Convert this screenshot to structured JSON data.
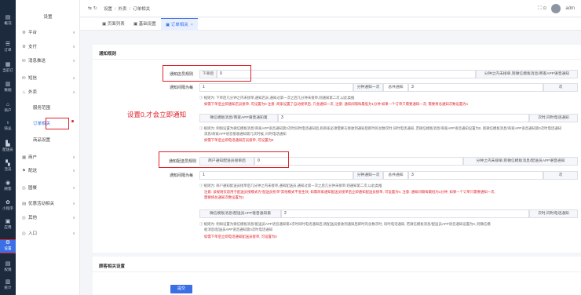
{
  "colors": {
    "accent": "#3a6fe6",
    "alert_red": "#e0222b",
    "nav_bg": "#1c2a3e"
  },
  "iconbar": [
    {
      "glyph": "▤",
      "label": "概况",
      "icon": "dashboard-icon"
    },
    {
      "glyph": "☰",
      "label": "订单",
      "icon": "order-icon"
    },
    {
      "glyph": "▦",
      "label": "当前订",
      "icon": "current-order-icon"
    },
    {
      "glyph": "▥",
      "label": "数据",
      "icon": "data-icon"
    },
    {
      "glyph": "⌂",
      "label": "商户",
      "icon": "merchant-icon"
    },
    {
      "glyph": "♁",
      "label": "骑丛",
      "icon": "rider-icon"
    },
    {
      "glyph": "▙",
      "label": "配送员",
      "icon": "delivery-icon"
    },
    {
      "glyph": "▚",
      "label": "活员",
      "icon": "member-icon"
    },
    {
      "glyph": "◉",
      "label": "顾客",
      "icon": "customer-icon"
    },
    {
      "glyph": "✿",
      "label": "小程序",
      "icon": "mini-program-icon"
    },
    {
      "glyph": "▣",
      "label": "应用",
      "icon": "apps-icon"
    },
    {
      "glyph": "⚙",
      "label": "设置",
      "icon": "settings-icon"
    },
    {
      "glyph": "▤",
      "label": "权限",
      "icon": "permission-icon"
    },
    {
      "glyph": "▥",
      "label": "统计",
      "icon": "stats-icon"
    }
  ],
  "sidebar": {
    "title": "设置",
    "items": [
      {
        "icon": "⚙",
        "label": "平台",
        "chev": "∨"
      },
      {
        "icon": "⚙",
        "label": "支付",
        "chev": "∨"
      },
      {
        "icon": "✉",
        "label": "消息推送",
        "chev": "∨"
      },
      {
        "icon": "✉",
        "label": "短信",
        "chev": "∨"
      },
      {
        "icon": "♨",
        "label": "外卖",
        "chev": "∧"
      },
      {
        "icon": "",
        "label": "服务范围",
        "chev": ""
      },
      {
        "icon": "",
        "label": "订单相关",
        "chev": ""
      },
      {
        "icon": "",
        "label": "商品设置",
        "chev": ""
      },
      {
        "icon": "▦",
        "label": "商户",
        "chev": "∨"
      },
      {
        "icon": "⚑",
        "label": "配送",
        "chev": "∨"
      },
      {
        "icon": "◎",
        "label": "圆餐",
        "chev": "∨"
      },
      {
        "icon": "▤",
        "label": "优惠活动相关",
        "chev": "∨"
      },
      {
        "icon": "◎",
        "label": "其他",
        "chev": "∨"
      },
      {
        "icon": "◎",
        "label": "入口",
        "chev": "∨"
      }
    ]
  },
  "topbar": {
    "nav_icons": "⇆ ↻",
    "crumbs": [
      "设置",
      "外卖",
      "订单相关"
    ],
    "crumb_sep": "/",
    "right_icons": "⛶ ⊙",
    "user": "adm"
  },
  "tabs": [
    {
      "label": "页面列表",
      "icon": "▣",
      "close": ""
    },
    {
      "label": "基础设置",
      "icon": "▣",
      "close": ""
    },
    {
      "label": "订单相关",
      "icon": "▣",
      "close": "×"
    }
  ],
  "section1": {
    "title": "通知规则",
    "row1": {
      "label": "通知店员规则",
      "prefix": "下单后",
      "value": "0",
      "suffix": "分钟之内未接单,则微信模板消息/商家APP语音通知"
    },
    "row2": {
      "label": "通知间隔为每",
      "value": "1",
      "mid": "分钟通知一次",
      "mid2": "总共通知",
      "value2": "3",
      "suffix": "次"
    },
    "hint1": "规则为: 下单后几分钟之内未接单,通知店员,通知过第一次之后几分钟未接单,则通知第二次,以此类推",
    "hint1_red": "如需下单后立即通知店员接单, 可设置为0 注意: 商家设置了自动接单后, 只会通知一次, 注意: 通知间隔每最低为1分钟 如果一个订单只需要通知一次, 需要将总通知次数设置为1",
    "row3": {
      "prefix": "微信模板消息/商家APP语音通知第",
      "value": "3",
      "suffix": "次时,同时电话通知"
    },
    "hint2": "规则为: 例如设置为微信模板消息/商家APP语音通知第3次时同时电话通知后,则商家必须需要在接收到通知后即时的总数次时,同时电话通知, 若微信模板消息/商家APP语音通知设置为0, 则微信模板消息/商家APP语音通知第0次时电话通知",
    "hint2b": "消息/商家APP语音接收通知第几次时候, 同时电话通知",
    "hint2_red": "如需下单后立即电话通知店员接单, 可设置为0",
    "row4": {
      "label": "通知配送员规则",
      "prefix": "商户通知配送员接单后",
      "value": "0",
      "suffix": "分钟之内未接单,则微信模板消息/配送员APP语音通知"
    },
    "row5": {
      "label": "通知间隔为每",
      "value": "1",
      "mid": "分钟通知一次",
      "mid2": "总共通知",
      "value2": "3",
      "suffix": "次"
    },
    "hint3": "规则为: 商户通知配送员接单后几分钟之内未接单,通知配送员,通知过第一次之后几分钟未接单,则通知第二次,以此类推",
    "hint3_red": "注意: 该规则仅适用于配送员接模式为\"配送员抢单\"其他模式不会生效, 如需商家通知配送员接单后立即通知配送员接单, 可设置为0, 注意: 通知间隔每最低为1分钟, 如果一个订单只需要通知一次,",
    "hint3_red2": "需要将总通知次数设置为1",
    "row6": {
      "prefix": "微信模板消息/配送员APP语音通知第",
      "value": "2",
      "suffix": "次时,同时电话通知"
    },
    "hint4": "规则为: 例如设置为微信模板消息/配送员APP语音通知第2次时同时电话通知后,则配送员接收到通知后即时的总数次时, 同时电话通知, 若微信模板消息/配送员APP语音通知设置为0, 则微信模",
    "hint4b": "板消息/配送员APP语音通知第0次时电话通知",
    "hint4_red": "如需下单后立即电话通知配送员接单, 可设置为0"
  },
  "annotation": "设置0,才会立即通知",
  "section2": {
    "title": "顾客相关设置"
  },
  "submit_label": "提交"
}
